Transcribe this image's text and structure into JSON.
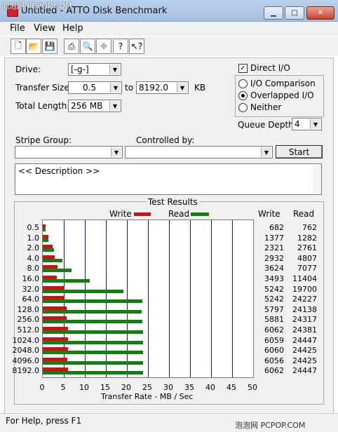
{
  "watermark": "泡泡网 PCPOP.COM",
  "window": {
    "title": "Untitled - ATTO Disk Benchmark"
  },
  "menu": [
    "File",
    "View",
    "Help"
  ],
  "toolbar_icons": [
    "new-icon",
    "open-icon",
    "save-icon",
    "print-icon",
    "print-preview-icon",
    "move-icon",
    "help-icon",
    "context-help-icon"
  ],
  "form": {
    "drive_label": "Drive:",
    "drive_value": "[-g-]",
    "transfer_size_label": "Transfer Size:",
    "transfer_from": "0.5",
    "to_label": "to",
    "transfer_to": "8192.0",
    "kb_label": "KB",
    "total_length_label": "Total Length:",
    "total_length_value": "256 MB",
    "direct_io_label": "Direct I/O",
    "direct_io_checked": true,
    "radio_io_comparison": "I/O Comparison",
    "radio_overlapped": "Overlapped I/O",
    "radio_neither": "Neither",
    "selected_mode": "Overlapped I/O",
    "queue_depth_label": "Queue Depth:",
    "queue_depth_value": "4",
    "stripe_group_label": "Stripe Group:",
    "controlled_by_label": "Controlled by:",
    "start_label": "Start",
    "description": "<< Description >>"
  },
  "results": {
    "title": "Test Results",
    "write_legend": "Write",
    "read_legend": "Read",
    "write_col": "Write",
    "read_col": "Read",
    "xaxis_label": "Transfer Rate - MB / Sec",
    "write_color": "#d01010",
    "read_color": "#118011"
  },
  "chart_data": {
    "type": "bar",
    "orientation": "horizontal",
    "xlim": [
      0,
      50
    ],
    "xticks": [
      "0",
      "5",
      "10",
      "15",
      "20",
      "25",
      "30",
      "35",
      "40",
      "45",
      "50"
    ],
    "xlabel": "Transfer Rate - MB / Sec",
    "categories": [
      "0.5",
      "1.0",
      "2.0",
      "4.0",
      "8.0",
      "16.0",
      "32.0",
      "64.0",
      "128.0",
      "256.0",
      "512.0",
      "1024.0",
      "2048.0",
      "4096.0",
      "8192.0"
    ],
    "series": [
      {
        "name": "Write",
        "values": [
          682,
          1377,
          2321,
          2932,
          3624,
          3493,
          5242,
          5242,
          5797,
          5881,
          6062,
          6059,
          6060,
          6056,
          6062
        ]
      },
      {
        "name": "Read",
        "values": [
          762,
          1282,
          2761,
          4807,
          7077,
          11404,
          19700,
          24227,
          24138,
          24317,
          24381,
          24447,
          24425,
          24425,
          24447
        ]
      }
    ]
  },
  "status": {
    "text": "For Help, press F1",
    "watermark": "泡泡网 PCPOP.COM"
  }
}
